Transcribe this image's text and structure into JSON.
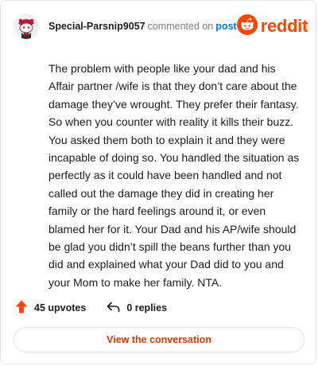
{
  "header": {
    "username": "Special-Parsnip9057",
    "commented_text": "commented on",
    "post_link": "post",
    "brand_name": "reddit",
    "brand_color": "#ff4500",
    "avatar_icon": "snoo-avatar-icon",
    "logo_icon": "reddit-alien-icon"
  },
  "comment": {
    "text": "The problem with people like your dad and his Affair partner /wife is that they don’t care about the damage they’ve wrought. They prefer their fantasy. So when you counter with reality it kills their buzz. You asked them both to explain it and they were incapable of doing so. You handled the situation as perfectly as it could have been handled and not called out the damage they did in creating her family or the hard feelings around it, or even blamed her for it. Your Dad and his AP/wife should be glad you didn’t spill the beans further than you did and explained what your Dad did to you and your Mom to make her family. NTA."
  },
  "actions": {
    "upvotes_label": "45 upvotes",
    "replies_label": "0 replies",
    "upvote_icon": "upvote-arrow-icon",
    "reply_icon": "reply-arrow-icon"
  },
  "footer": {
    "view_label": "View the conversation",
    "accent_color": "#d93900"
  }
}
